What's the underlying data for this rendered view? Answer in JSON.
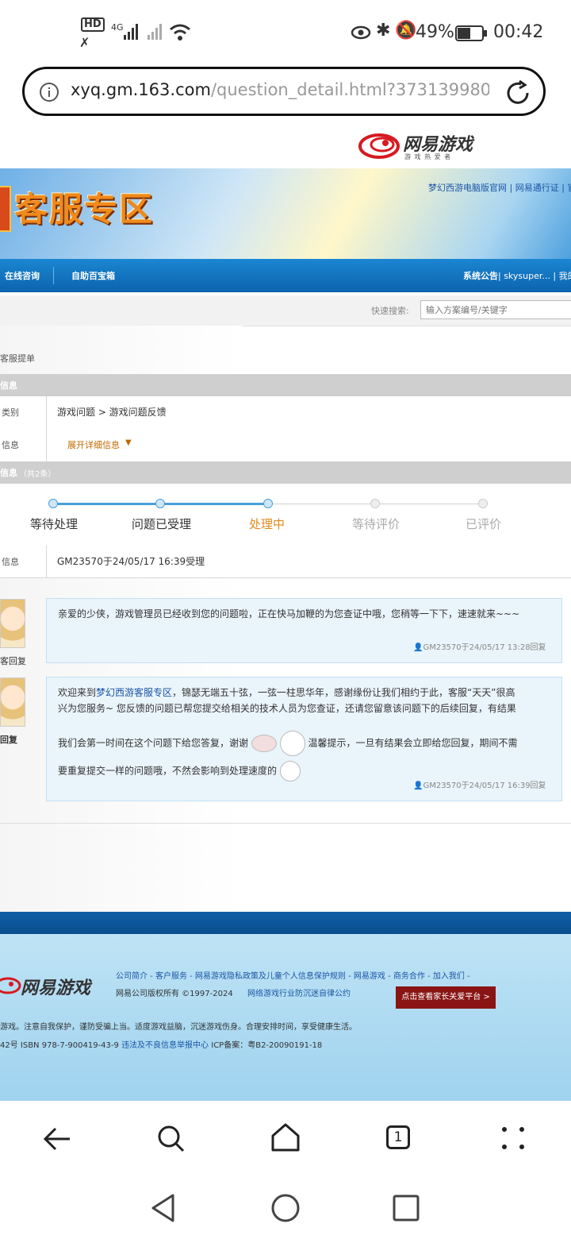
{
  "status_bar": {
    "hd": "HD",
    "signal_4g": "4G",
    "battery": "49%",
    "time": "00:42"
  },
  "browser": {
    "url_domain": "xyq.gm.163.com",
    "url_path": "/question_detail.html?373139980"
  },
  "brand": {
    "logo_text": "网易游戏",
    "logo_sub": "游 戏 热 爱 者"
  },
  "banner": {
    "title": "客服专区",
    "top_links": "梦幻西游电脑版官网 | 网易通行证 | 官"
  },
  "nav": {
    "items": [
      "在线咨询",
      "自助百宝箱"
    ],
    "right": "系统公告",
    "user": " | skysuper... | 我的"
  },
  "search": {
    "label": "快速搜索:",
    "placeholder": "输入方案编号/关键字"
  },
  "page": {
    "breadcrumb": "客服提单",
    "section1": "信息",
    "category_label": "类别",
    "category_value": "游戏问题 > 游戏问题反馈",
    "info_label": "信息",
    "expand_text": "展开详细信息",
    "section2": "信息",
    "section2_count": "（共2条）",
    "steps": [
      "等待处理",
      "问题已受理",
      "处理中",
      "等待评价",
      "已评价"
    ],
    "handle_label": "信息",
    "handle_value": "GM23570于24/05/17 16:39受理"
  },
  "messages": [
    {
      "tag": "客回复",
      "text": "亲爱的少侠，游戏管理员已经收到您的问题啦，正在快马加鞭的为您查证中哦，您稍等一下下，速速就来~~~",
      "meta": "GM23570于24/05/17 13:28回复"
    },
    {
      "tag": "回复",
      "text_pre": "欢迎来到",
      "text_link": "梦幻西游客服专区",
      "text_line1": "，锦瑟无端五十弦，一弦一柱思华年，感谢缘份让我们相约于此，客服“天天”很高",
      "text_line2": "兴为您服务~ 您反馈的问题已帮您提交给相关的技术人员为您查证，还请您留意该问题下的后续回复，有结果",
      "text_line3a": "我们会第一时间在这个问题下给您答复，谢谢",
      "text_line3b": "温馨提示，一旦有结果会立即给您回复，期间不需",
      "text_line4": "要重复提交一样的问题哦，不然会影响到处理速度的",
      "meta": "GM23570于24/05/17 16:39回复"
    }
  ],
  "footer": {
    "links": "公司简介 - 客户服务 - 网易游戏隐私政策及儿童个人信息保护规则 - 网易游戏 - 商务合作 - 加入我们 -",
    "copyright": "网易公司版权所有 ©1997-2024",
    "selfdiscipline": "网络游戏行业防沉迷自律公约",
    "parent_btn": "点击查看家长关爱平台 >",
    "notice": "游戏。注意自我保护，谨防受骗上当。适度游戏益脑，沉迷游戏伤身。合理安排时间，享受健康生活。",
    "isbn": "42号 ISBN 978-7-900419-43-9",
    "report": "违法及不良信息举报中心",
    "icp": "ICP备案：粤B2-20090191-18"
  },
  "bottom_nav": {
    "tabs_count": "1"
  }
}
